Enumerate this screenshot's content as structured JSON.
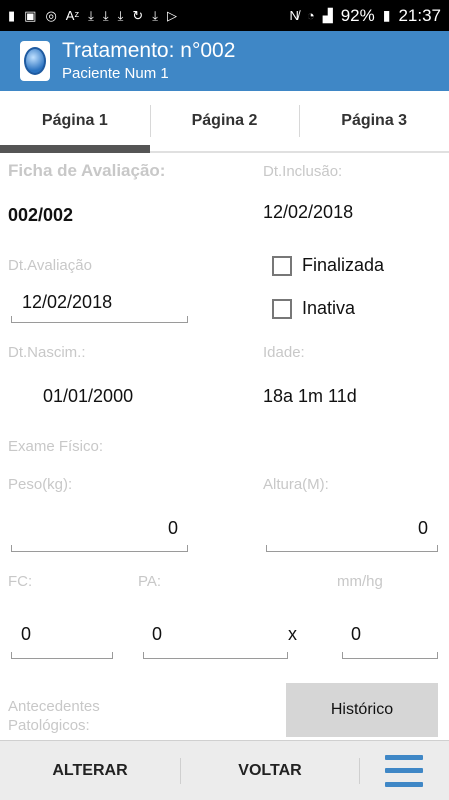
{
  "status_bar": {
    "left_icons": [
      "notification-icon",
      "media-icon",
      "cast-icon",
      "font-icon",
      "download-icon",
      "download-icon",
      "download-icon",
      "sync-icon",
      "download-icon",
      "play-store-icon"
    ],
    "battery": "92%",
    "time": "21:37"
  },
  "app_bar": {
    "title": "Tratamento: n°002",
    "subtitle": "Paciente Num 1"
  },
  "tabs": [
    {
      "label": "Página 1",
      "active": true
    },
    {
      "label": "Página 2",
      "active": false
    },
    {
      "label": "Página 3",
      "active": false
    }
  ],
  "form": {
    "ficha_label": "Ficha de Avaliação:",
    "ficha_value": "002/002",
    "inclusao_label": "Dt.Inclusão:",
    "inclusao_value": "12/02/2018",
    "avaliacao_label": "Dt.Avaliação",
    "avaliacao_value": "12/02/2018",
    "finalizada_label": "Finalizada",
    "inativa_label": "Inativa",
    "nascim_label": "Dt.Nascim.:",
    "nascim_value": "01/01/2000",
    "idade_label": "Idade:",
    "idade_value": "18a 1m 11d",
    "exame_label": "Exame Físico:",
    "peso_label": "Peso(kg):",
    "peso_value": "0",
    "altura_label": "Altura(M):",
    "altura_value": "0",
    "fc_label": "FC:",
    "fc_value": "0",
    "pa_label": "PA:",
    "pa_value": "0",
    "mmhg_label": "mm/hg",
    "x_sep": "x",
    "pa2_value": "0",
    "antecedentes_label_1": "Antecedentes",
    "antecedentes_label_2": "Patológicos:",
    "historico_button": "Histórico"
  },
  "bottom_bar": {
    "alterar": "ALTERAR",
    "voltar": "VOLTAR"
  },
  "colors": {
    "accent": "#3f87c6",
    "status_bar": "#000000"
  }
}
